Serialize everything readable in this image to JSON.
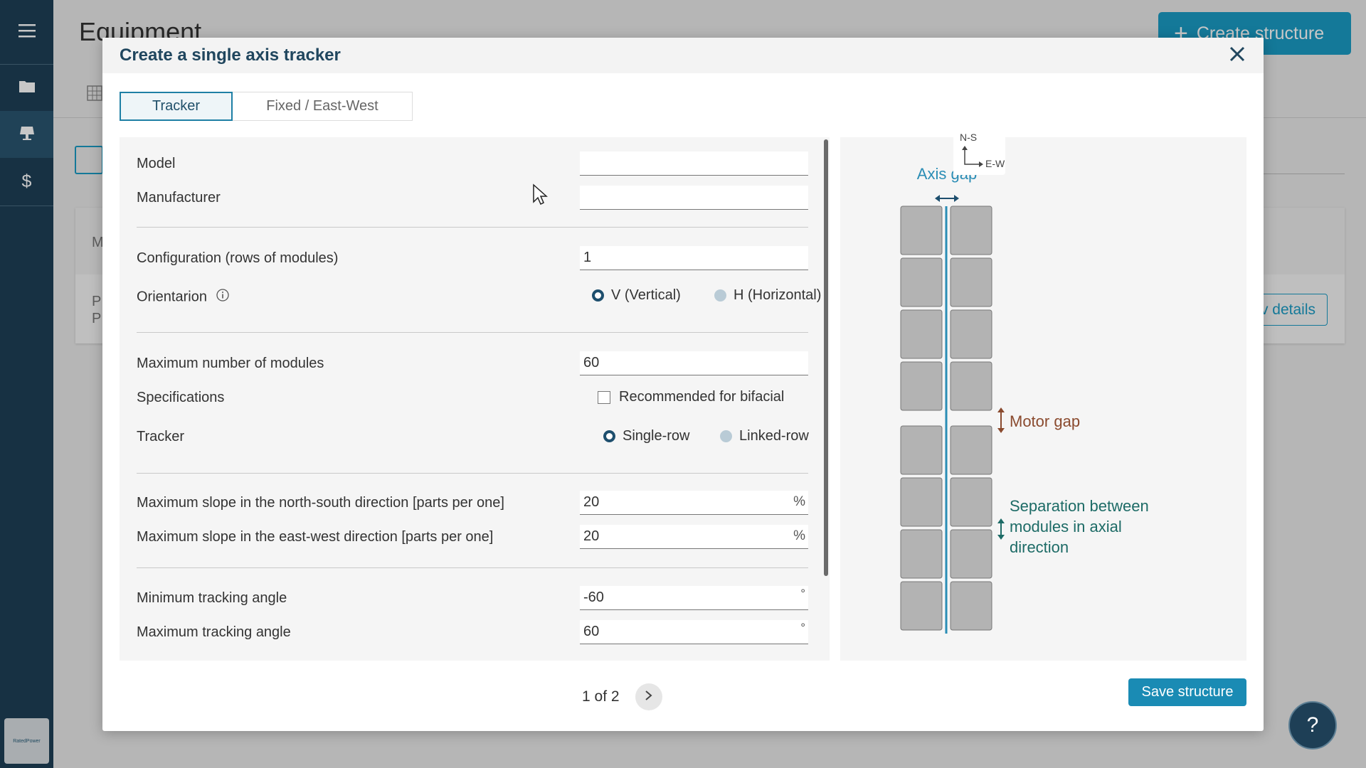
{
  "sidebar": {
    "items": [
      {
        "icon": "menu-icon"
      },
      {
        "icon": "folder-icon"
      },
      {
        "icon": "tracker-icon"
      },
      {
        "icon": "dollar-icon"
      }
    ],
    "logo_text": "RatedPower"
  },
  "page": {
    "title": "Equipment",
    "create_button": "Create structure",
    "card_m": "M",
    "card_p1": "P",
    "card_p2": "P",
    "details_button": "v details"
  },
  "modal": {
    "title": "Create a single axis tracker",
    "tabs": [
      {
        "label": "Tracker",
        "active": true
      },
      {
        "label": "Fixed / East-West",
        "active": false
      }
    ],
    "form": {
      "model": {
        "label": "Model",
        "value": ""
      },
      "manufacturer": {
        "label": "Manufacturer",
        "value": ""
      },
      "configuration": {
        "label": "Configuration (rows of modules)",
        "value": "1"
      },
      "orientation": {
        "label": "Orientarion",
        "options": [
          "V (Vertical)",
          "H (Horizontal)"
        ],
        "selected": "V (Vertical)"
      },
      "max_modules": {
        "label": "Maximum number of modules",
        "value": "60"
      },
      "specifications": {
        "label": "Specifications",
        "checkbox_label": "Recommended for bifacial",
        "checked": false
      },
      "tracker": {
        "label": "Tracker",
        "options": [
          "Single-row",
          "Linked-row"
        ],
        "selected": "Single-row"
      },
      "slope_ns": {
        "label": "Maximum slope in the north-south direction [parts per one]",
        "value": "20",
        "unit": "%"
      },
      "slope_ew": {
        "label": "Maximum slope in the east-west direction [parts per one]",
        "value": "20",
        "unit": "%"
      },
      "min_angle": {
        "label": "Minimum tracking angle",
        "value": "-60",
        "unit": "°"
      },
      "max_angle": {
        "label": "Maximum tracking angle",
        "value": "60",
        "unit": "°"
      }
    },
    "diagram": {
      "axis_gap": "Axis gap",
      "motor_gap": "Motor gap",
      "separation_line1": "Separation between",
      "separation_line2": "modules in axial",
      "separation_line3": "direction",
      "compass_ns": "N-S",
      "compass_ew": "E-W"
    },
    "pager": "1 of 2",
    "save_button": "Save structure"
  },
  "help": "?",
  "colors": {
    "sidebar": "#1e3f56",
    "accent": "#1a8bb4",
    "title": "#20465e",
    "diagram_blue": "#2a8db5",
    "diagram_brown": "#8a4a2e",
    "diagram_green": "#1d6b66"
  }
}
